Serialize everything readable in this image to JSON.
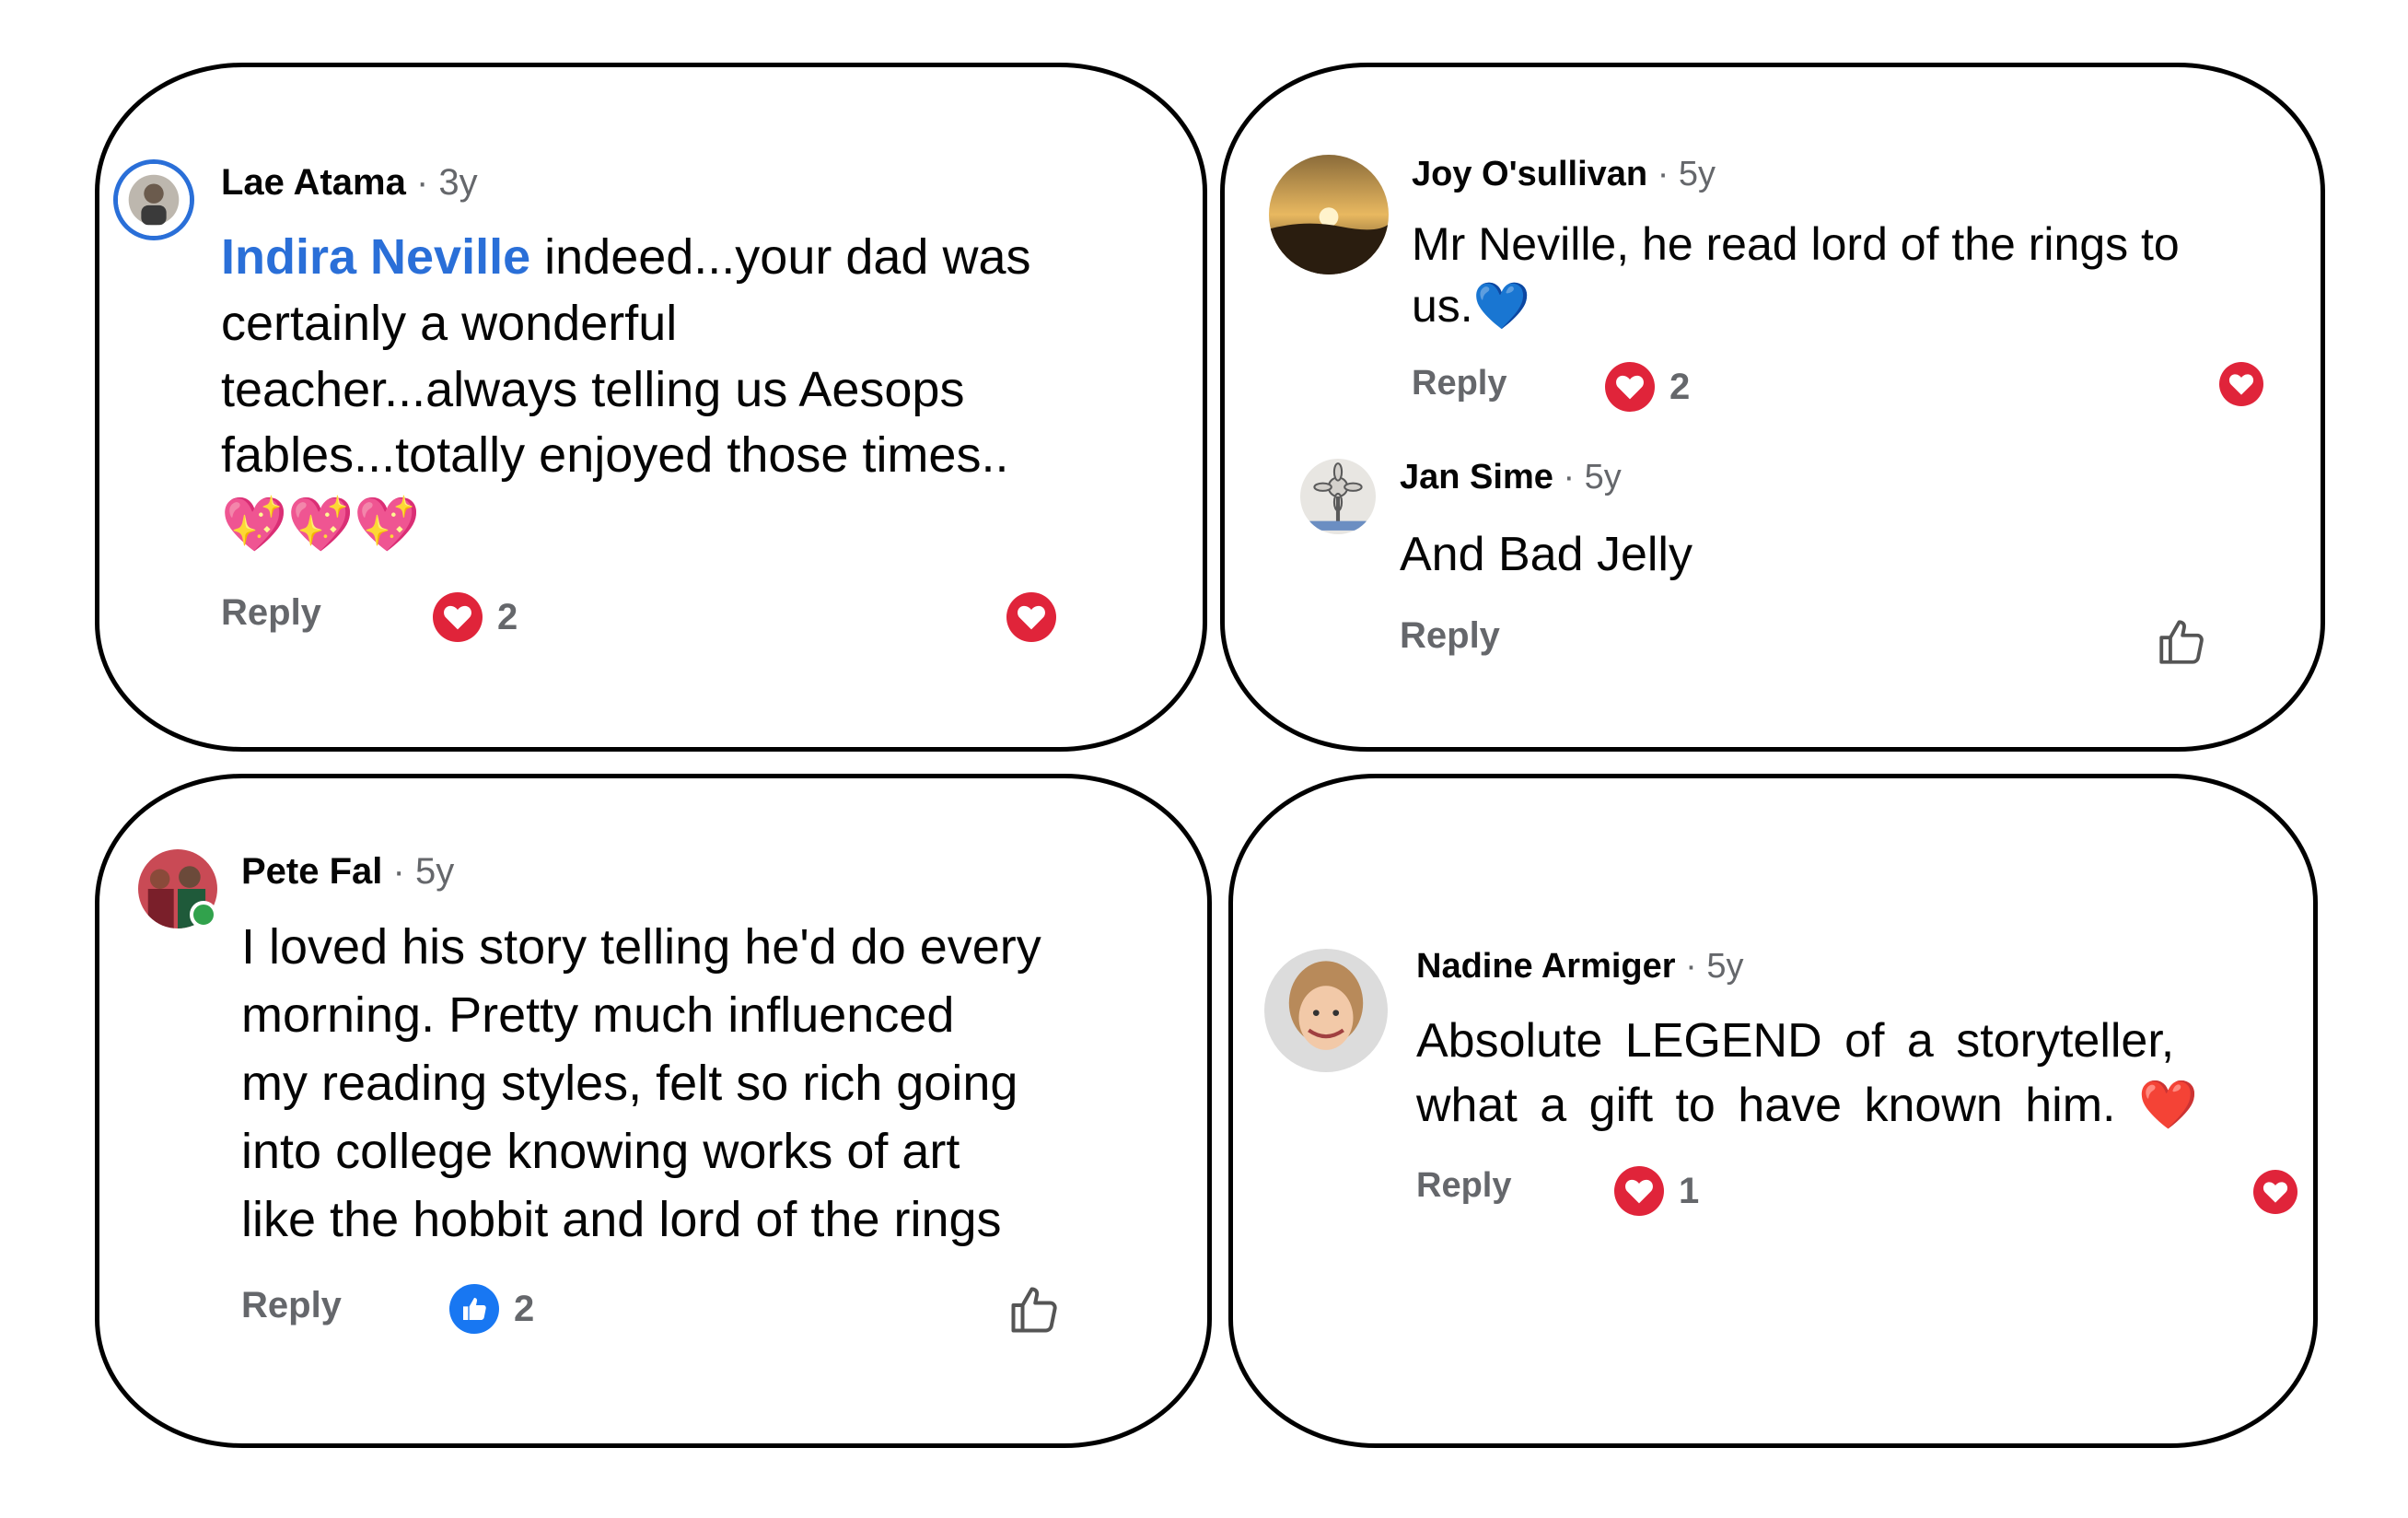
{
  "comments": [
    {
      "name": "Lae Atama",
      "meta": "· 3y",
      "mention": "Indira Neville",
      "lines": [
        " indeed...your dad was",
        "certainly a wonderful",
        "teacher...always telling us Aesops",
        "fables...totally enjoyed those times.."
      ],
      "emoji": "💖💖💖",
      "reply": "Reply",
      "reaction": "heart",
      "count": "2",
      "side_icon": "heart-icon"
    },
    {
      "name": "Joy O'sullivan",
      "meta": "· 5y",
      "lines": [
        "Mr Neville,  he read lord of the rings to",
        "us."
      ],
      "emoji": "💙",
      "reply": "Reply",
      "reaction": "heart",
      "count": "2",
      "side_icon": "heart-icon"
    },
    {
      "name": "Jan Sime",
      "meta": "· 5y",
      "lines": [
        "And Bad Jelly"
      ],
      "reply": "Reply",
      "side_icon": "thumbs-up-icon"
    },
    {
      "name": "Pete Fal",
      "meta": "· 5y",
      "lines": [
        "I loved his story telling he'd do every",
        "morning. Pretty much influenced",
        "my reading styles, felt so rich going",
        "into college knowing works of art",
        "like the hobbit and lord of the rings"
      ],
      "reply": "Reply",
      "reaction": "like",
      "count": "2",
      "side_icon": "thumbs-up-icon"
    },
    {
      "name": "Nadine Armiger",
      "meta": "· 5y",
      "lines": [
        "Absolute LEGEND of a storyteller,",
        "what a gift to have known him."
      ],
      "emoji": "❤️",
      "reply": "Reply",
      "reaction": "heart",
      "count": "1",
      "side_icon": "heart-icon"
    }
  ],
  "colors": {
    "heart": "#e0243a",
    "like": "#1877f2",
    "mention": "#2a6fd8",
    "meta_gray": "#65676b"
  }
}
